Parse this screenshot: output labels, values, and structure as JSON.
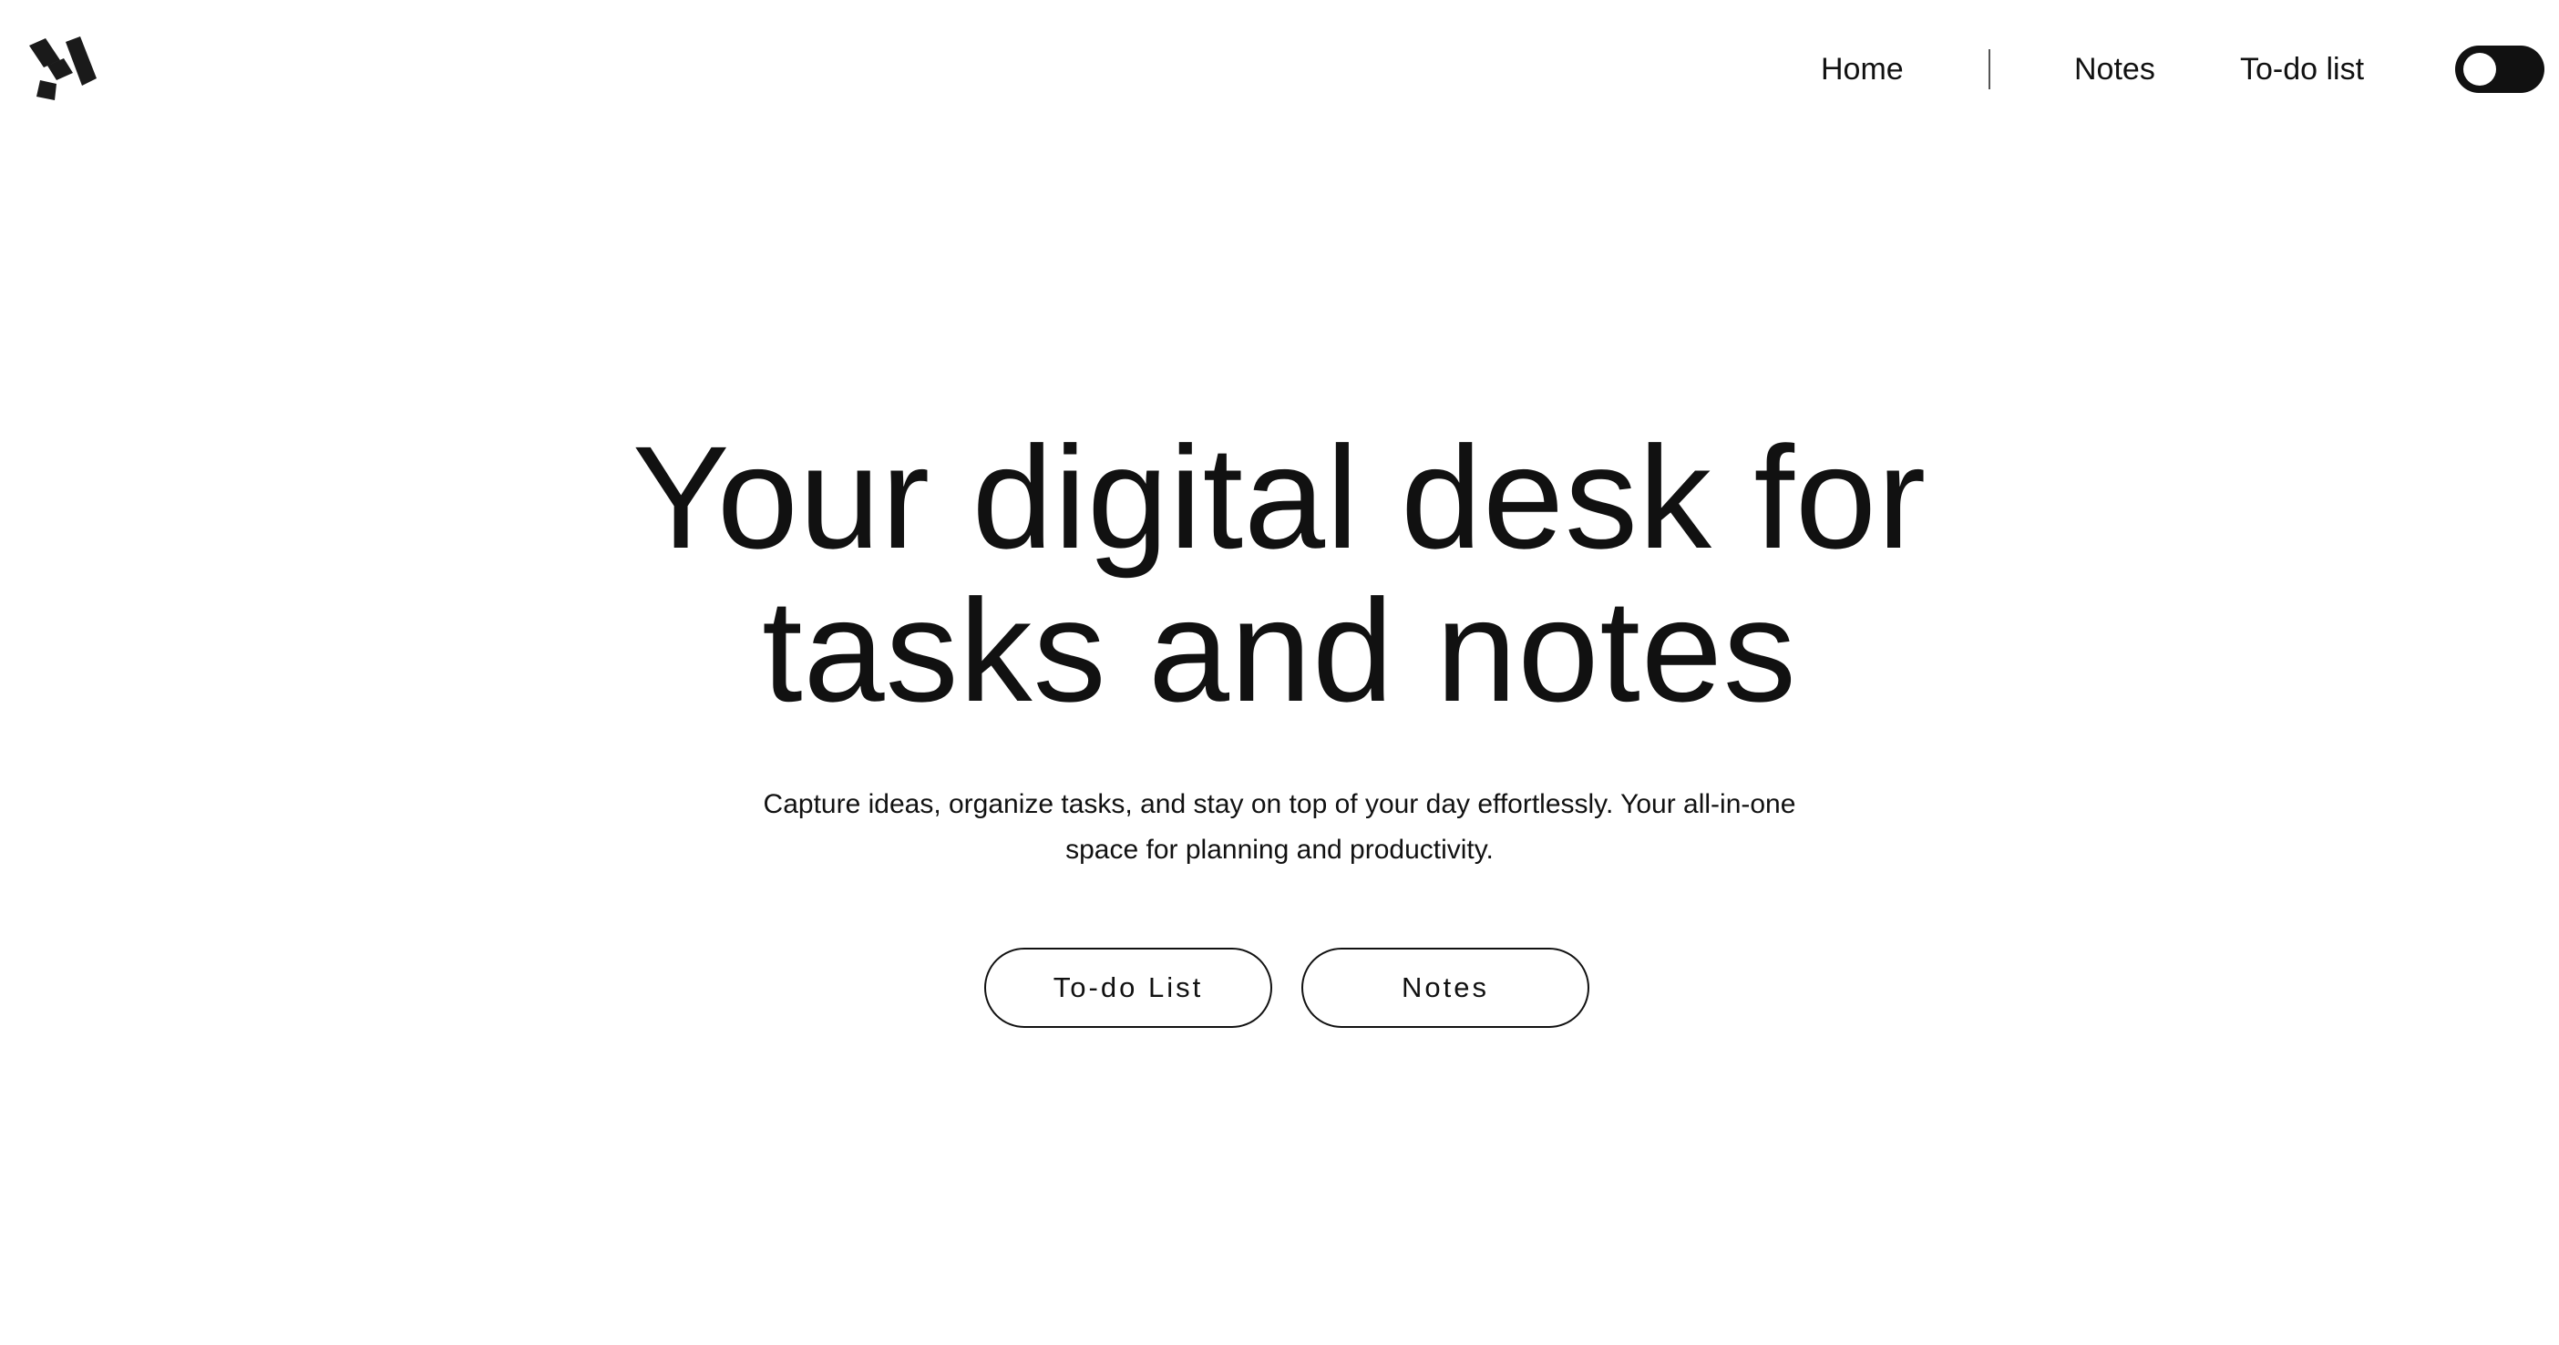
{
  "header": {
    "logo_icon": "brand-logo-icon",
    "nav": {
      "home_label": "Home",
      "notes_label": "Notes",
      "todo_label": "To-do list"
    },
    "theme_toggle": {
      "state": "off",
      "track_color": "#111111",
      "knob_color": "#ffffff"
    }
  },
  "hero": {
    "title_line1": "Your digital desk for",
    "title_line2": "tasks and notes",
    "subtitle": "Capture ideas, organize tasks, and stay on top of your day effortlessly. Your all-in-one space for planning and productivity.",
    "buttons": {
      "todo_label": "To-do List",
      "notes_label": "Notes"
    }
  },
  "colors": {
    "background": "#ffffff",
    "text": "#111111"
  }
}
